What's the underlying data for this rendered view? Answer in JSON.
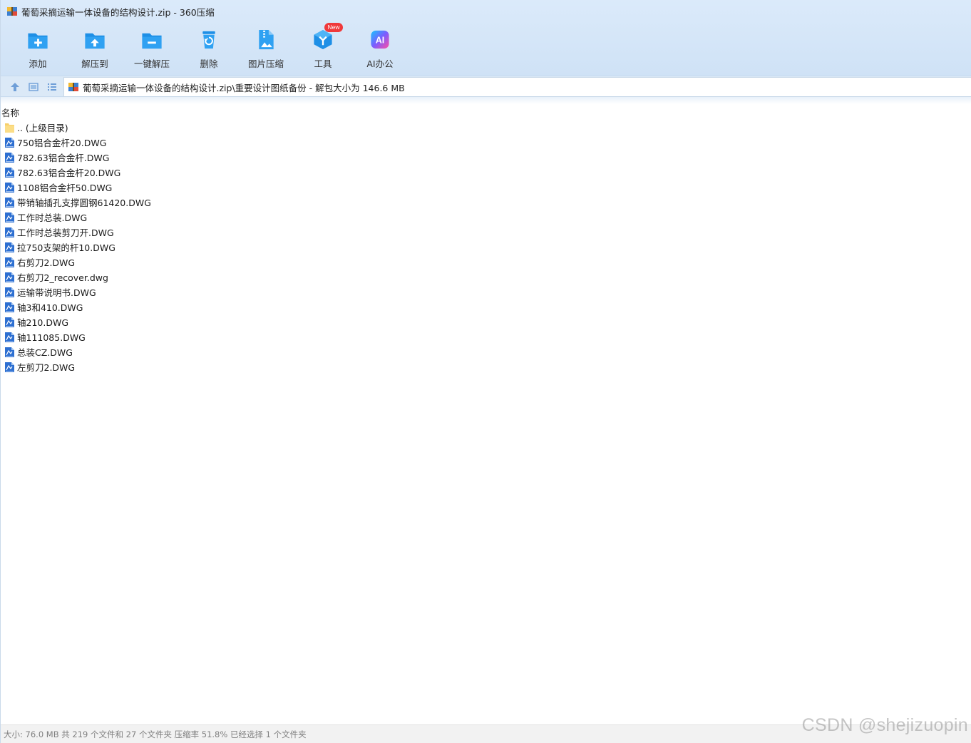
{
  "window": {
    "title": "葡萄采摘运输一体设备的结构设计.zip - 360压缩"
  },
  "toolbar": {
    "items": [
      {
        "label": "添加",
        "icon": "add-icon"
      },
      {
        "label": "解压到",
        "icon": "extract-to-icon"
      },
      {
        "label": "一键解压",
        "icon": "one-click-extract-icon"
      },
      {
        "label": "删除",
        "icon": "delete-icon"
      },
      {
        "label": "图片压缩",
        "icon": "image-compress-icon"
      },
      {
        "label": "工具",
        "icon": "tools-icon"
      },
      {
        "label": "AI办公",
        "icon": "ai-office-icon"
      }
    ],
    "new_badge": "New"
  },
  "address": {
    "path": "葡萄采摘运输一体设备的结构设计.zip\\重要设计图纸备份 - 解包大小为 146.6 MB"
  },
  "list": {
    "header_name": "名称",
    "rows": [
      {
        "name": ".. (上级目录)",
        "type": "folder"
      },
      {
        "name": "750铝合金杆20.DWG",
        "type": "dwg"
      },
      {
        "name": "782.63铝合金杆.DWG",
        "type": "dwg"
      },
      {
        "name": "782.63铝合金杆20.DWG",
        "type": "dwg"
      },
      {
        "name": "1108铝合金杆50.DWG",
        "type": "dwg"
      },
      {
        "name": "带销轴插孔支撑圆钢61420.DWG",
        "type": "dwg"
      },
      {
        "name": "工作时总装.DWG",
        "type": "dwg"
      },
      {
        "name": "工作时总装剪刀开.DWG",
        "type": "dwg"
      },
      {
        "name": "拉750支架的杆10.DWG",
        "type": "dwg"
      },
      {
        "name": "右剪刀2.DWG",
        "type": "dwg"
      },
      {
        "name": "右剪刀2_recover.dwg",
        "type": "dwg"
      },
      {
        "name": "运输带说明书.DWG",
        "type": "dwg"
      },
      {
        "name": "轴3和410.DWG",
        "type": "dwg"
      },
      {
        "name": "轴210.DWG",
        "type": "dwg"
      },
      {
        "name": "轴111085.DWG",
        "type": "dwg"
      },
      {
        "name": "总装CZ.DWG",
        "type": "dwg"
      },
      {
        "name": "左剪刀2.DWG",
        "type": "dwg"
      }
    ]
  },
  "status": {
    "text": "大小: 76.0 MB 共 219 个文件和 27 个文件夹 压缩率 51.8% 已经选择 1 个文件夹"
  },
  "watermark": "CSDN @shejizuopin",
  "colors": {
    "accent_blue": "#1e8fe6",
    "badge_red": "#f0393b",
    "toolbar_bg": "#d6e7f8"
  }
}
